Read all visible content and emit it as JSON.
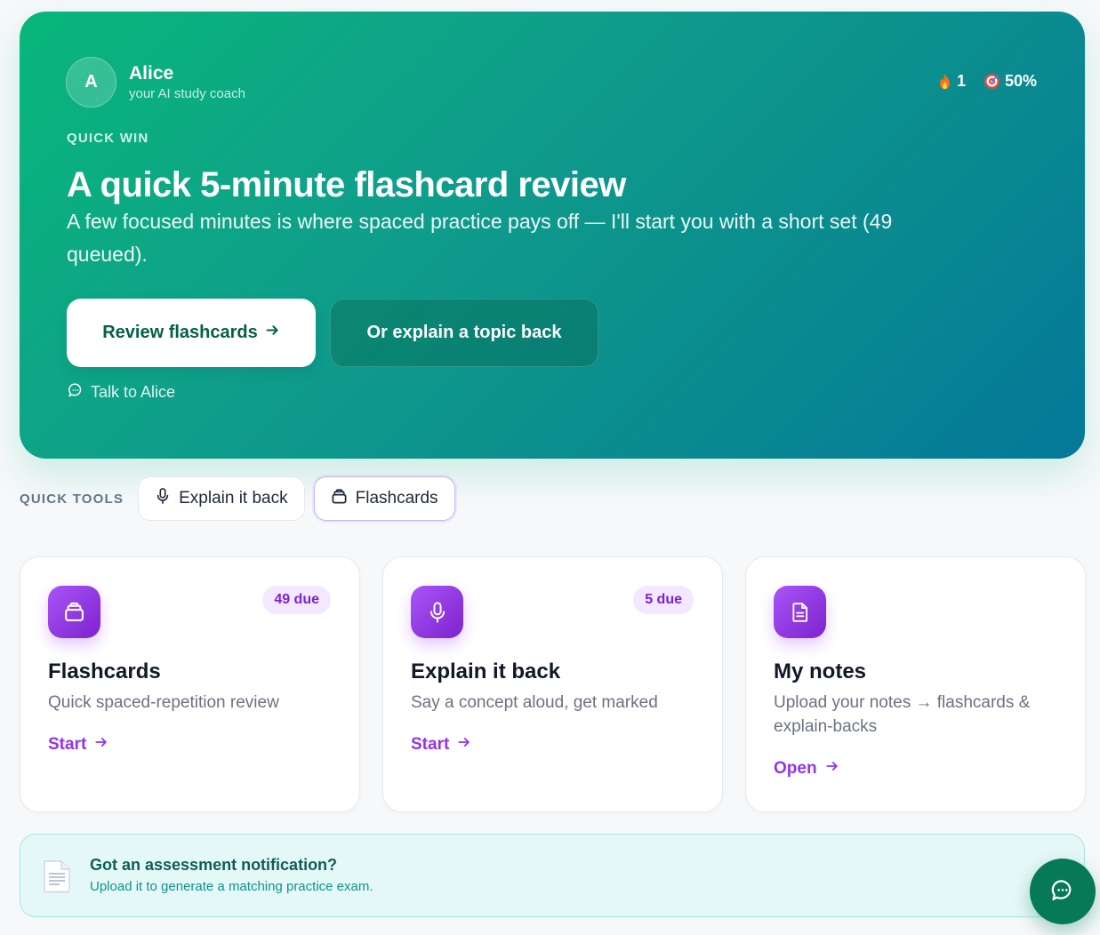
{
  "coach": {
    "initial": "A",
    "name": "Alice",
    "subtitle": "your AI study coach"
  },
  "stats": {
    "streak": "1",
    "streak_icon": "fire-icon",
    "accuracy": "50%",
    "accuracy_icon": "target-icon"
  },
  "hero": {
    "eyebrow": "QUICK WIN",
    "title": "A quick 5-minute flashcard review",
    "body": "A few focused minutes is where spaced practice pays off — I'll start you with a short set (49 queued).",
    "primary_label": "Review flashcards",
    "secondary_label": "Or explain a topic back",
    "talk_label": "Talk to Alice"
  },
  "quick_tools": {
    "label": "QUICK TOOLS",
    "items": [
      {
        "label": "Explain it back",
        "icon": "microphone-icon",
        "active": false
      },
      {
        "label": "Flashcards",
        "icon": "card-stack-icon",
        "active": true
      }
    ]
  },
  "cards": [
    {
      "title": "Flashcards",
      "description": "Quick spaced-repetition review",
      "badge": "49 due",
      "link": "Start",
      "icon": "card-stack-icon"
    },
    {
      "title": "Explain it back",
      "description": "Say a concept aloud, get marked",
      "badge": "5 due",
      "link": "Start",
      "icon": "microphone-icon"
    },
    {
      "title": "My notes",
      "description": "Upload your notes → flashcards & explain-backs",
      "badge": "",
      "link": "Open",
      "icon": "document-icon"
    }
  ],
  "banner": {
    "title": "Got an assessment notification?",
    "subtitle": "Upload it to generate a matching practice exam.",
    "icon": "page-icon"
  },
  "fab": {
    "icon": "chat-icon"
  },
  "colors": {
    "hero_start": "#08b77a",
    "hero_end": "#04789a",
    "accent_purple": "#9333ea",
    "badge_bg": "#f3e8ff",
    "banner_bg": "#e5f8f8",
    "fab_bg": "#057a55"
  }
}
